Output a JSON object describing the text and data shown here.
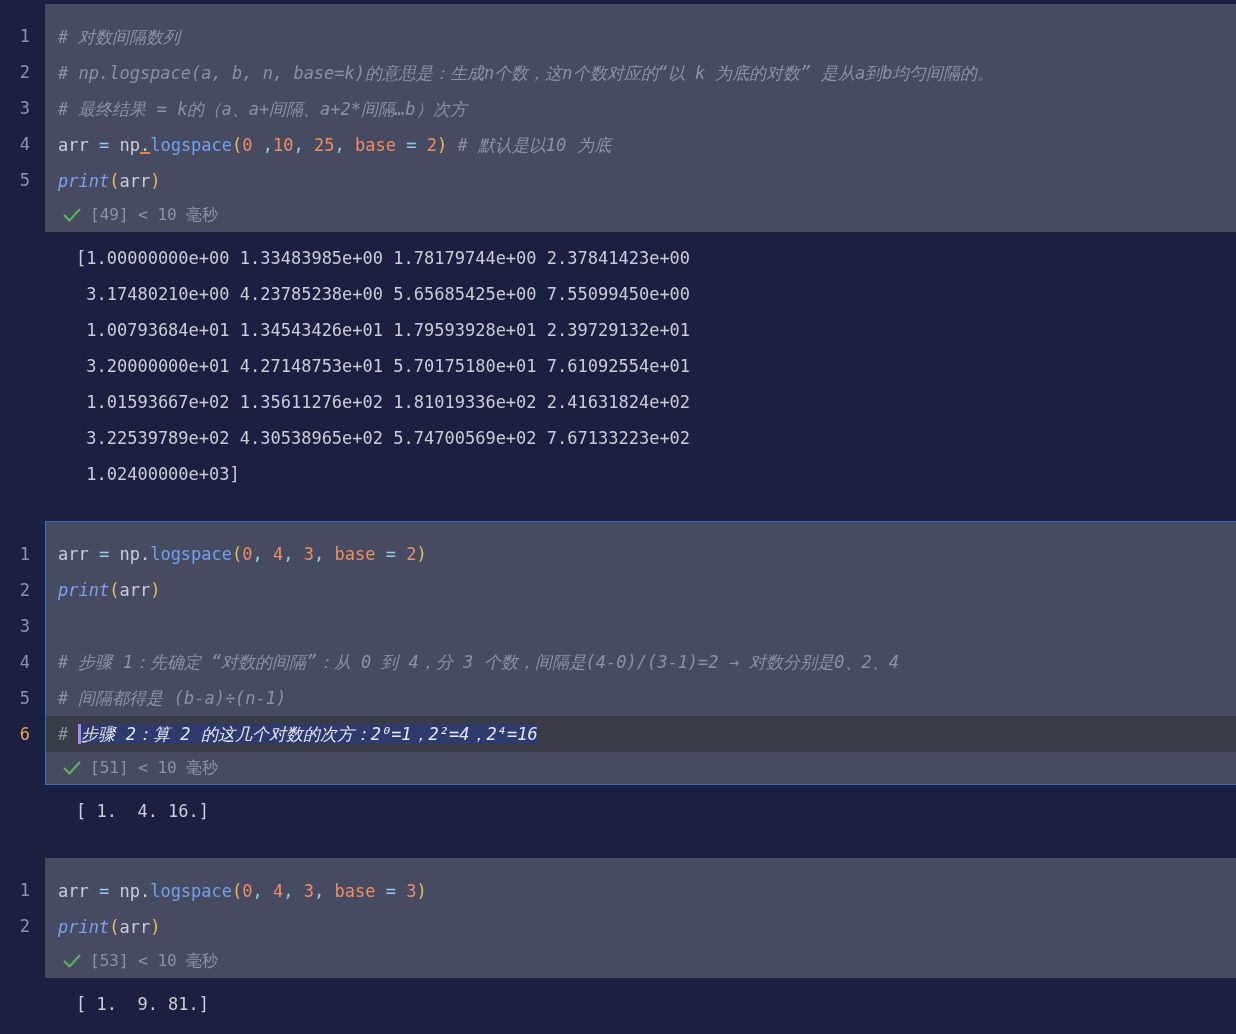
{
  "cells": [
    {
      "selected": false,
      "lines": [
        {
          "number": "1",
          "current": false,
          "tokens": [
            {
              "kind": "comment",
              "text": "# 对数间隔数列"
            }
          ]
        },
        {
          "number": "2",
          "current": false,
          "tokens": [
            {
              "kind": "comment",
              "text": "# np.logspace(a, b, n, base=k)的意思是：生成n个数，这n个数对应的“以 k 为底的对数” 是从a到b均匀间隔的。"
            }
          ]
        },
        {
          "number": "3",
          "current": false,
          "tokens": [
            {
              "kind": "comment",
              "text": "# 最终结果 = k的（a、a+间隔、a+2*间隔…b）次方"
            }
          ]
        },
        {
          "number": "4",
          "current": false,
          "tokens": [
            {
              "kind": "plain",
              "text": "arr "
            },
            {
              "kind": "op",
              "text": "="
            },
            {
              "kind": "plain",
              "text": " np"
            },
            {
              "kind": "plain",
              "text": ".",
              "warning": true
            },
            {
              "kind": "method",
              "text": "logspace"
            },
            {
              "kind": "paren",
              "text": "("
            },
            {
              "kind": "num",
              "text": "0"
            },
            {
              "kind": "op",
              "text": " ,"
            },
            {
              "kind": "num",
              "text": "10"
            },
            {
              "kind": "op",
              "text": ", "
            },
            {
              "kind": "num",
              "text": "25"
            },
            {
              "kind": "op",
              "text": ", "
            },
            {
              "kind": "kw",
              "text": "base"
            },
            {
              "kind": "op",
              "text": " = "
            },
            {
              "kind": "num",
              "text": "2"
            },
            {
              "kind": "paren",
              "text": ")"
            },
            {
              "kind": "comment",
              "text": " # 默认是以10 为底"
            }
          ]
        },
        {
          "number": "5",
          "current": false,
          "tokens": [
            {
              "kind": "func",
              "text": "print"
            },
            {
              "kind": "paren",
              "text": "("
            },
            {
              "kind": "plain",
              "text": "arr"
            },
            {
              "kind": "paren",
              "text": ")"
            }
          ]
        }
      ],
      "status": "[49] < 10 毫秒",
      "output": [
        "[1.00000000e+00 1.33483985e+00 1.78179744e+00 2.37841423e+00",
        " 3.17480210e+00 4.23785238e+00 5.65685425e+00 7.55099450e+00",
        " 1.00793684e+01 1.34543426e+01 1.79593928e+01 2.39729132e+01",
        " 3.20000000e+01 4.27148753e+01 5.70175180e+01 7.61092554e+01",
        " 1.01593667e+02 1.35611276e+02 1.81019336e+02 2.41631824e+02",
        " 3.22539789e+02 4.30538965e+02 5.74700569e+02 7.67133223e+02",
        " 1.02400000e+03]"
      ]
    },
    {
      "selected": true,
      "lines": [
        {
          "number": "1",
          "current": false,
          "tokens": [
            {
              "kind": "plain",
              "text": "arr "
            },
            {
              "kind": "op",
              "text": "="
            },
            {
              "kind": "plain",
              "text": " np."
            },
            {
              "kind": "method",
              "text": "logspace"
            },
            {
              "kind": "paren",
              "text": "("
            },
            {
              "kind": "num",
              "text": "0"
            },
            {
              "kind": "op",
              "text": ", "
            },
            {
              "kind": "num",
              "text": "4"
            },
            {
              "kind": "op",
              "text": ", "
            },
            {
              "kind": "num",
              "text": "3"
            },
            {
              "kind": "op",
              "text": ", "
            },
            {
              "kind": "kw",
              "text": "base"
            },
            {
              "kind": "op",
              "text": " = "
            },
            {
              "kind": "num",
              "text": "2"
            },
            {
              "kind": "paren",
              "text": ")"
            }
          ]
        },
        {
          "number": "2",
          "current": false,
          "tokens": [
            {
              "kind": "func",
              "text": "print"
            },
            {
              "kind": "paren",
              "text": "("
            },
            {
              "kind": "plain",
              "text": "arr"
            },
            {
              "kind": "paren",
              "text": ")"
            }
          ]
        },
        {
          "number": "3",
          "current": false
        },
        {
          "number": "4",
          "current": false,
          "tokens": [
            {
              "kind": "comment",
              "text": "# 步骤 1：先确定 “对数的间隔”：从 0 到 4，分 3 个数，间隔是(4-0)/(3-1)=2 → 对数分别是0、2、4"
            }
          ]
        },
        {
          "number": "5",
          "current": false,
          "tokens": [
            {
              "kind": "comment",
              "text": "# 间隔都得是 (b-a)÷(n-1)"
            }
          ]
        },
        {
          "number": "6",
          "current": true,
          "tokens": [
            {
              "kind": "comment",
              "text": "# "
            },
            {
              "kind": "comment",
              "text": "步骤 2：算 2 的这几个对数的次方：2⁰=1，2²=4，2⁴=16",
              "selected": true
            }
          ]
        }
      ],
      "status": "[51] < 10 毫秒",
      "output": [
        "[ 1.  4. 16.]"
      ]
    },
    {
      "selected": false,
      "lines": [
        {
          "number": "1",
          "current": false,
          "tokens": [
            {
              "kind": "plain",
              "text": "arr "
            },
            {
              "kind": "op",
              "text": "="
            },
            {
              "kind": "plain",
              "text": " np."
            },
            {
              "kind": "method",
              "text": "logspace"
            },
            {
              "kind": "paren",
              "text": "("
            },
            {
              "kind": "num",
              "text": "0"
            },
            {
              "kind": "op",
              "text": ", "
            },
            {
              "kind": "num",
              "text": "4"
            },
            {
              "kind": "op",
              "text": ", "
            },
            {
              "kind": "num",
              "text": "3"
            },
            {
              "kind": "op",
              "text": ", "
            },
            {
              "kind": "kw",
              "text": "base"
            },
            {
              "kind": "op",
              "text": " = "
            },
            {
              "kind": "num",
              "text": "3"
            },
            {
              "kind": "paren",
              "text": ")"
            }
          ]
        },
        {
          "number": "2",
          "current": false,
          "tokens": [
            {
              "kind": "func",
              "text": "print"
            },
            {
              "kind": "paren",
              "text": "("
            },
            {
              "kind": "plain",
              "text": "arr"
            },
            {
              "kind": "paren",
              "text": ")"
            }
          ]
        }
      ],
      "status": "[53] < 10 毫秒",
      "output": [
        "[ 1.  9. 81.]"
      ]
    }
  ]
}
